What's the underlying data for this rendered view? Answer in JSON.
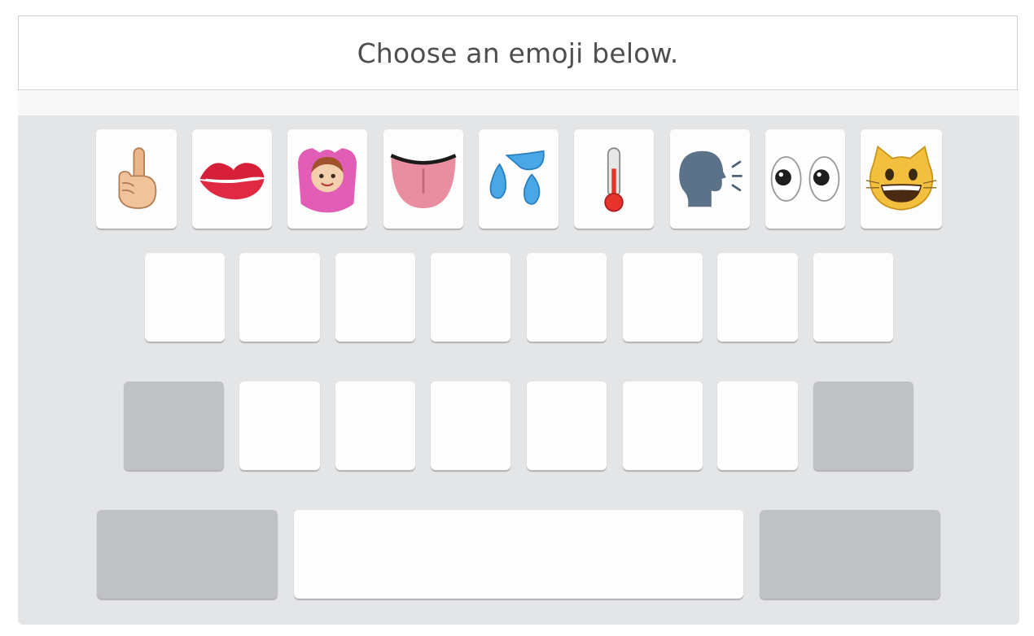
{
  "prompt": {
    "text": "Choose an emoji below."
  },
  "emoji_row": [
    {
      "name": "pointing-finger-icon"
    },
    {
      "name": "kiss-lips-icon"
    },
    {
      "name": "woman-ok-gesture-icon"
    },
    {
      "name": "tongue-icon"
    },
    {
      "name": "sweat-droplets-icon"
    },
    {
      "name": "thermometer-icon"
    },
    {
      "name": "speaking-head-icon"
    },
    {
      "name": "eyes-icon"
    },
    {
      "name": "grinning-cat-icon"
    }
  ],
  "colors": {
    "keyboard_bg": "#e4e5e7",
    "key_bg": "#fdfdfd",
    "special_key_bg": "#bfc1c5",
    "prompt_text": "#4e4e4e"
  }
}
